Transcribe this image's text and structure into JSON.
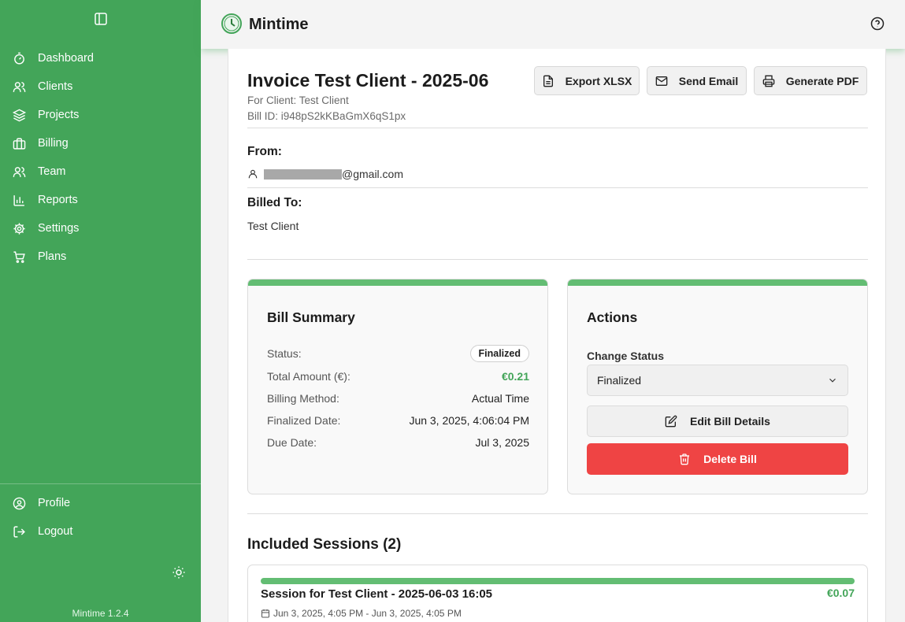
{
  "app": {
    "name": "Mintime",
    "version": "Mintime 1.2.4"
  },
  "sidebar": {
    "items": [
      {
        "label": "Dashboard",
        "icon": "timer-icon"
      },
      {
        "label": "Clients",
        "icon": "users-icon"
      },
      {
        "label": "Projects",
        "icon": "layers-icon"
      },
      {
        "label": "Billing",
        "icon": "briefcase-icon"
      },
      {
        "label": "Team",
        "icon": "team-icon"
      },
      {
        "label": "Reports",
        "icon": "bar-chart-icon"
      },
      {
        "label": "Settings",
        "icon": "gear-icon"
      },
      {
        "label": "Plans",
        "icon": "cart-icon"
      }
    ],
    "bottom_items": [
      {
        "label": "Profile",
        "icon": "user-circle-icon"
      },
      {
        "label": "Logout",
        "icon": "logout-icon"
      }
    ]
  },
  "invoice": {
    "title": "Invoice Test Client - 2025-06",
    "for_client": "For Client: Test Client",
    "bill_id": "Bill ID: i948pS2kKBaGmX6qS1px"
  },
  "toolbar": {
    "export_label": "Export XLSX",
    "email_label": "Send Email",
    "pdf_label": "Generate PDF"
  },
  "from": {
    "label": "From:",
    "email_suffix": "@gmail.com"
  },
  "billed_to": {
    "label": "Billed To:",
    "name": "Test Client"
  },
  "summary": {
    "title": "Bill Summary",
    "status_label": "Status:",
    "status_value": "Finalized",
    "total_label": "Total Amount (€):",
    "total_value": "€0.21",
    "method_label": "Billing Method:",
    "method_value": "Actual Time",
    "finalized_label": "Finalized Date:",
    "finalized_value": "Jun 3, 2025, 4:06:04 PM",
    "due_label": "Due Date:",
    "due_value": "Jul 3, 2025"
  },
  "actions": {
    "title": "Actions",
    "change_status_label": "Change Status",
    "status_selected": "Finalized",
    "edit_label": "Edit Bill Details",
    "delete_label": "Delete Bill"
  },
  "sessions": {
    "title": "Included Sessions (2)",
    "items": [
      {
        "name": "Session for Test Client - 2025-06-03 16:05",
        "amount": "€0.07",
        "time": "Jun 3, 2025, 4:05 PM - Jun 3, 2025, 4:05 PM"
      }
    ]
  },
  "colors": {
    "sidebar": "#43a559",
    "accent_bar": "#63bd73",
    "danger": "#ef4444",
    "amount": "#43a559"
  }
}
